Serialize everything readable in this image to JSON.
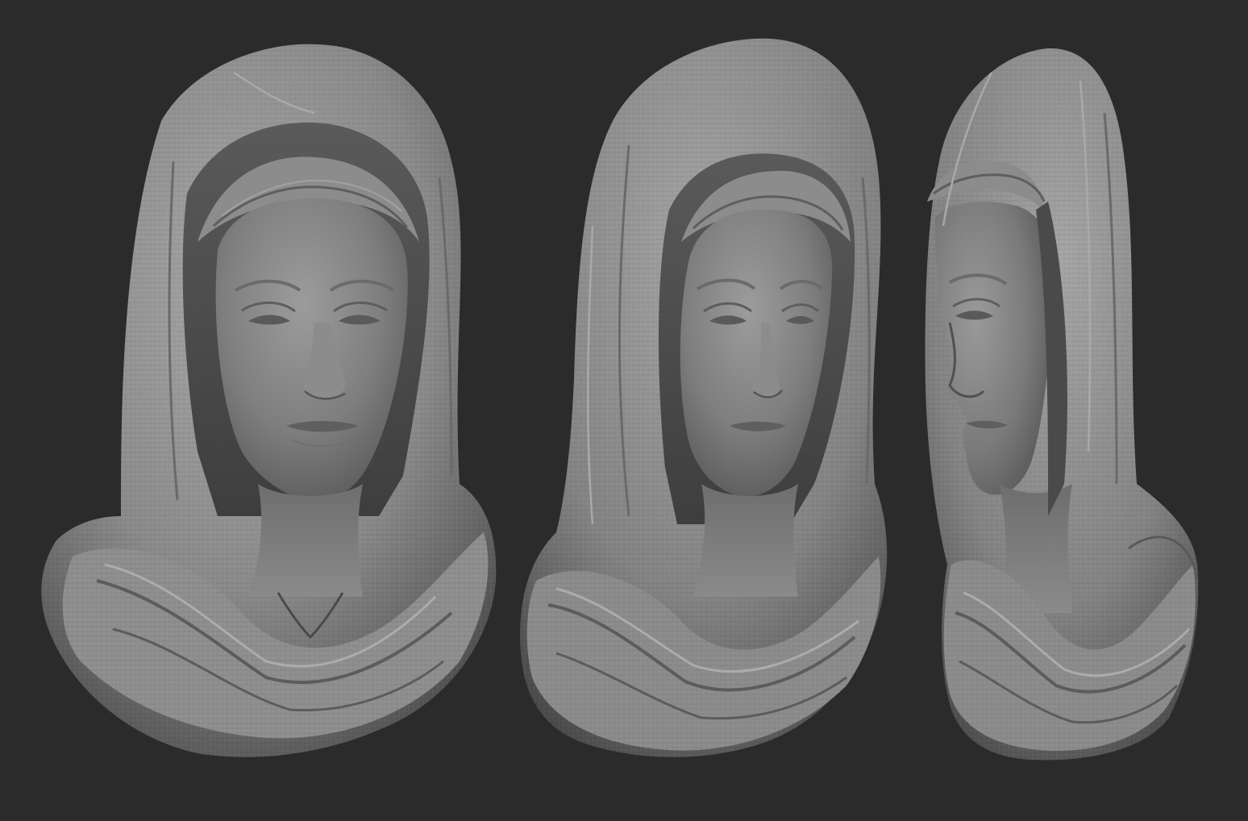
{
  "scene": {
    "background_color": "#2b2b2c",
    "material_color": "#8f8f8f",
    "subject": "hooded-female-bust-sculpt",
    "views": [
      {
        "id": "front",
        "orientation": "front"
      },
      {
        "id": "three-quarter",
        "orientation": "three-quarter-right"
      },
      {
        "id": "profile",
        "orientation": "side-right"
      }
    ]
  }
}
